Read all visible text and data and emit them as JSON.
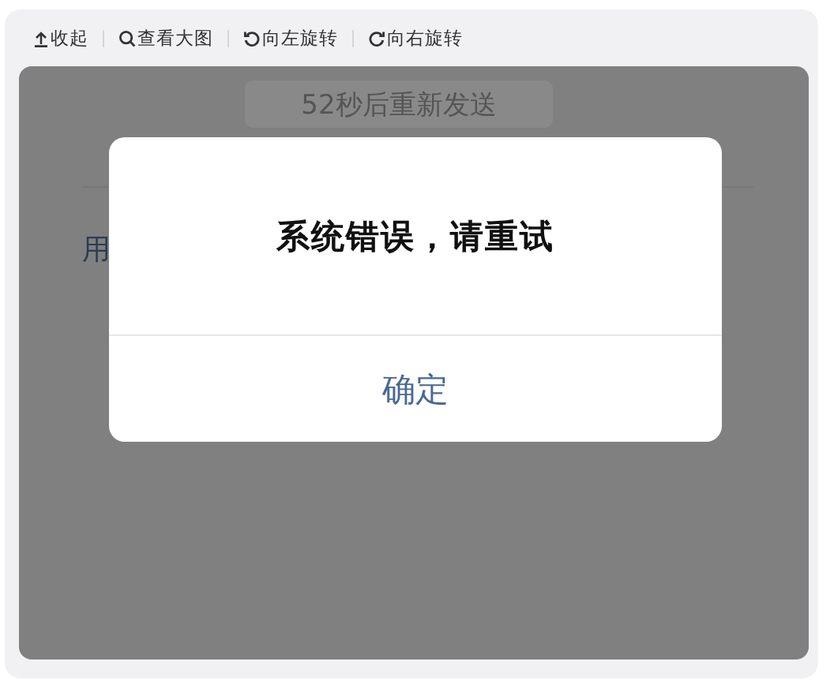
{
  "toolbar": [
    {
      "kind": "collapse",
      "label": "收起"
    },
    {
      "kind": "zoom",
      "label": "查看大图"
    },
    {
      "kind": "rotate-left",
      "label": "向左旋转"
    },
    {
      "kind": "rotate-right",
      "label": "向右旋转"
    }
  ],
  "background": {
    "resend_button": "52秒后重新发送",
    "field_label": "用"
  },
  "dialog": {
    "message": "系统错误，请重试",
    "button": "确定"
  }
}
